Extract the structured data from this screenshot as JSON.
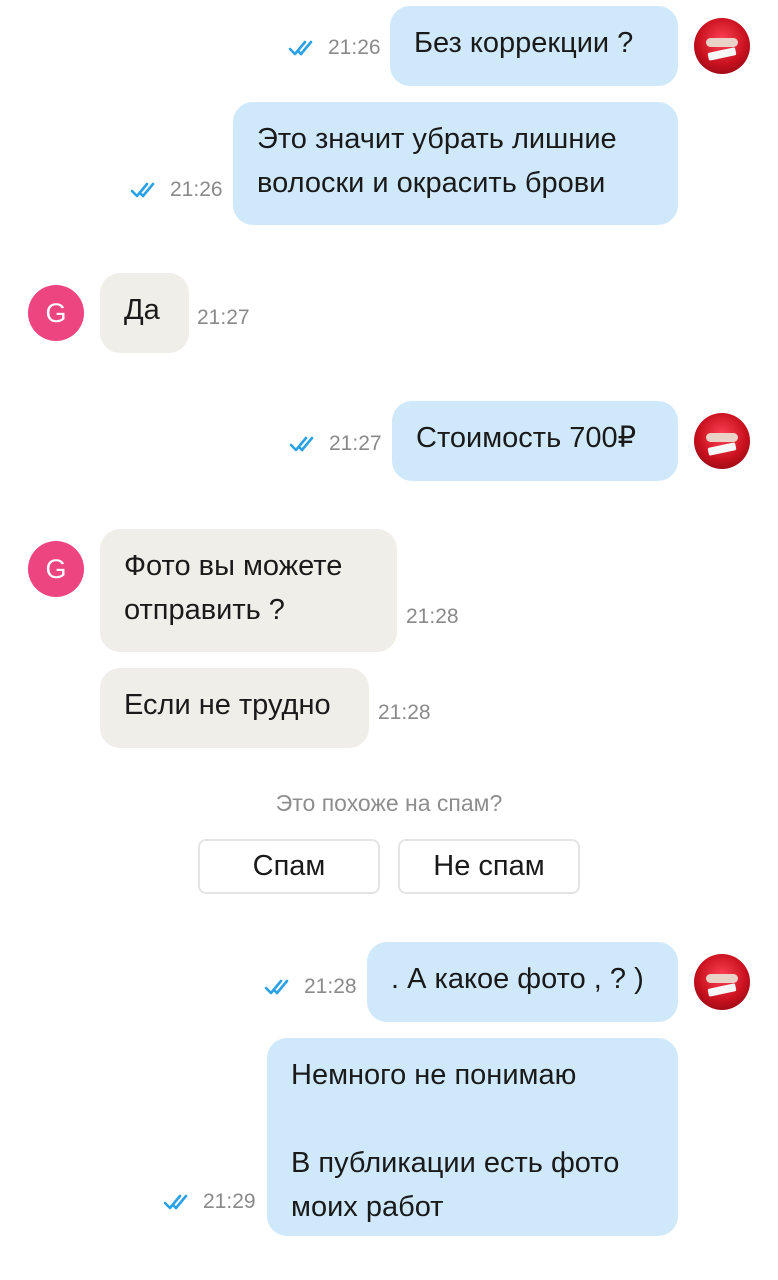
{
  "colors": {
    "outgoing_bubble": "#cfe9fb",
    "incoming_bubble": "#f0eee9",
    "read_ticks": "#2aa1e6",
    "contact_avatar": "#ec4580",
    "timestamp": "#8a8a8a"
  },
  "contact": {
    "initial": "G"
  },
  "messages": [
    {
      "direction": "out",
      "text": "Без коррекции ?",
      "time": "21:26",
      "status_icon": "double-check-icon"
    },
    {
      "direction": "out",
      "text": "Это значит убрать лишние\nволоски и окрасить брови",
      "time": "21:26",
      "status_icon": "double-check-icon"
    },
    {
      "direction": "in",
      "text": "Да",
      "time": "21:27"
    },
    {
      "direction": "out",
      "text": "Стоимость 700₽",
      "time": "21:27",
      "status_icon": "double-check-icon"
    },
    {
      "direction": "in",
      "text": "Фото вы можете\nотправить ?",
      "time": "21:28"
    },
    {
      "direction": "in",
      "text": "Если не трудно",
      "time": "21:28"
    },
    {
      "direction": "out",
      "text": ". А какое фото , ? )",
      "time": "21:28",
      "status_icon": "double-check-icon"
    },
    {
      "direction": "out",
      "text": "Немного не понимаю\n\nВ публикации есть фото\nмоих работ",
      "time": "21:29",
      "status_icon": "double-check-icon"
    }
  ],
  "spam_prompt": {
    "question": "Это похоже на спам?",
    "spam_label": "Спам",
    "not_spam_label": "Не спам"
  }
}
